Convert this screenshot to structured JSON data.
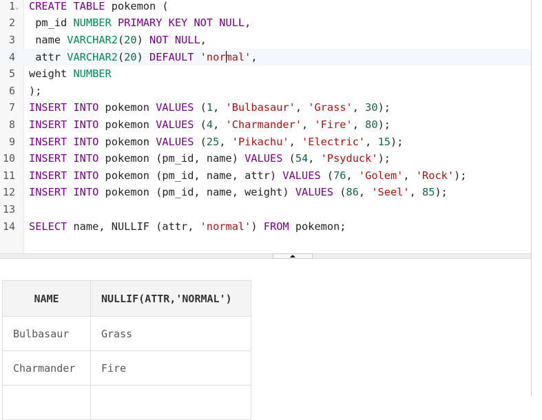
{
  "editor": {
    "active_line": 4,
    "lines": [
      {
        "n": "1",
        "tokens": [
          [
            "kw",
            "CREATE TABLE"
          ],
          [
            "pl",
            " pokemon ("
          ]
        ]
      },
      {
        "n": "2",
        "tokens": [
          [
            "pl",
            " pm_id "
          ],
          [
            "ty",
            "NUMBER"
          ],
          [
            "pl",
            " "
          ],
          [
            "kw",
            "PRIMARY KEY NOT NULL"
          ],
          [
            "pl",
            ","
          ]
        ]
      },
      {
        "n": "3",
        "tokens": [
          [
            "pl",
            " name "
          ],
          [
            "ty",
            "VARCHAR2"
          ],
          [
            "pl",
            "("
          ],
          [
            "num",
            "20"
          ],
          [
            "pl",
            ") "
          ],
          [
            "kw",
            "NOT NULL"
          ],
          [
            "pl",
            ","
          ]
        ]
      },
      {
        "n": "4",
        "tokens": [
          [
            "pl",
            " attr "
          ],
          [
            "ty",
            "VARCHAR2"
          ],
          [
            "pl",
            "("
          ],
          [
            "num",
            "20"
          ],
          [
            "pl",
            ") "
          ],
          [
            "kw",
            "DEFAULT"
          ],
          [
            "pl",
            " "
          ],
          [
            "str",
            "'nor"
          ],
          [
            "caret",
            ""
          ],
          [
            "str",
            "mal'"
          ],
          [
            "pl",
            ","
          ]
        ]
      },
      {
        "n": "5",
        "tokens": [
          [
            "pl",
            "weight "
          ],
          [
            "ty",
            "NUMBER"
          ]
        ]
      },
      {
        "n": "6",
        "tokens": [
          [
            "pl",
            ");"
          ]
        ]
      },
      {
        "n": "7",
        "tokens": [
          [
            "kw",
            "INSERT INTO"
          ],
          [
            "pl",
            " pokemon "
          ],
          [
            "kw",
            "VALUES"
          ],
          [
            "pl",
            " ("
          ],
          [
            "num",
            "1"
          ],
          [
            "pl",
            ", "
          ],
          [
            "str",
            "'Bulbasaur'"
          ],
          [
            "pl",
            ", "
          ],
          [
            "str",
            "'Grass'"
          ],
          [
            "pl",
            ", "
          ],
          [
            "num",
            "30"
          ],
          [
            "pl",
            ");"
          ]
        ]
      },
      {
        "n": "8",
        "tokens": [
          [
            "kw",
            "INSERT INTO"
          ],
          [
            "pl",
            " pokemon "
          ],
          [
            "kw",
            "VALUES"
          ],
          [
            "pl",
            " ("
          ],
          [
            "num",
            "4"
          ],
          [
            "pl",
            ", "
          ],
          [
            "str",
            "'Charmander'"
          ],
          [
            "pl",
            ", "
          ],
          [
            "str",
            "'Fire'"
          ],
          [
            "pl",
            ", "
          ],
          [
            "num",
            "80"
          ],
          [
            "pl",
            ");"
          ]
        ]
      },
      {
        "n": "9",
        "tokens": [
          [
            "kw",
            "INSERT INTO"
          ],
          [
            "pl",
            " pokemon "
          ],
          [
            "kw",
            "VALUES"
          ],
          [
            "pl",
            " ("
          ],
          [
            "num",
            "25"
          ],
          [
            "pl",
            ", "
          ],
          [
            "str",
            "'Pikachu'"
          ],
          [
            "pl",
            ", "
          ],
          [
            "str",
            "'Electric'"
          ],
          [
            "pl",
            ", "
          ],
          [
            "num",
            "15"
          ],
          [
            "pl",
            ");"
          ]
        ]
      },
      {
        "n": "10",
        "tokens": [
          [
            "kw",
            "INSERT INTO"
          ],
          [
            "pl",
            " pokemon (pm_id, name) "
          ],
          [
            "kw",
            "VALUES"
          ],
          [
            "pl",
            " ("
          ],
          [
            "num",
            "54"
          ],
          [
            "pl",
            ", "
          ],
          [
            "str",
            "'Psyduck'"
          ],
          [
            "pl",
            ");"
          ]
        ]
      },
      {
        "n": "11",
        "tokens": [
          [
            "kw",
            "INSERT INTO"
          ],
          [
            "pl",
            " pokemon (pm_id, name, attr) "
          ],
          [
            "kw",
            "VALUES"
          ],
          [
            "pl",
            " ("
          ],
          [
            "num",
            "76"
          ],
          [
            "pl",
            ", "
          ],
          [
            "str",
            "'Golem'"
          ],
          [
            "pl",
            ", "
          ],
          [
            "str",
            "'Rock'"
          ],
          [
            "pl",
            ");"
          ]
        ]
      },
      {
        "n": "12",
        "tokens": [
          [
            "kw",
            "INSERT INTO"
          ],
          [
            "pl",
            " pokemon (pm_id, name, weight) "
          ],
          [
            "kw",
            "VALUES"
          ],
          [
            "pl",
            " ("
          ],
          [
            "num",
            "86"
          ],
          [
            "pl",
            ", "
          ],
          [
            "str",
            "'Seel'"
          ],
          [
            "pl",
            ", "
          ],
          [
            "num",
            "85"
          ],
          [
            "pl",
            ");"
          ]
        ]
      },
      {
        "n": "13",
        "tokens": []
      },
      {
        "n": "14",
        "tokens": [
          [
            "kw",
            "SELECT"
          ],
          [
            "pl",
            " name, NULLIF (attr, "
          ],
          [
            "str",
            "'normal'"
          ],
          [
            "pl",
            ") "
          ],
          [
            "kw",
            "FROM"
          ],
          [
            "pl",
            " pokemon;"
          ]
        ]
      }
    ]
  },
  "results": {
    "headers": [
      "NAME",
      "NULLIF(ATTR,'NORMAL')"
    ],
    "rows": [
      [
        "Bulbasaur",
        "Grass"
      ],
      [
        "Charmander",
        "Fire"
      ],
      [
        "",
        ""
      ]
    ]
  }
}
